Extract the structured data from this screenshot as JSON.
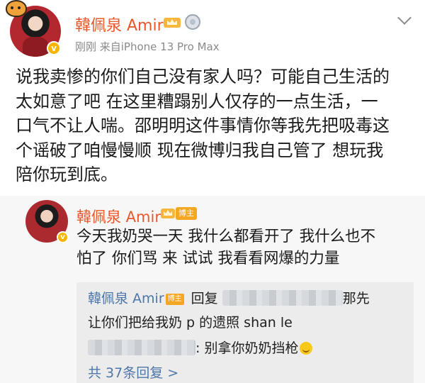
{
  "post": {
    "username": "韓佩泉 Amir",
    "meta": "刚刚  来自iPhone 13 Pro Max",
    "verified_mark": "v",
    "text": "说我卖惨的你们自己没有家人吗？可能自己生活的\n太如意了吧 在这里糟蹋别人仅存的一点生活，一\n口气不让人喘。邵明明这件事情你等我先把吸毒这\n个谣破了咱慢慢顺 现在微博归我自己管了 想玩我\n陪你玩到底。"
  },
  "reply": {
    "username": "韓佩泉 Amir",
    "blogger_tag": "博主",
    "text": "今天我奶哭一天 我什么都看开了 我什么也不\n怕了 你们骂 来 试试 我看看网爆的力量",
    "comments": {
      "line1_user": "韓佩泉 Amir",
      "line1_tag": "博主",
      "line1_action": " 回复 ",
      "line1_tail": "那先",
      "line2": "让你们把给我奶 p 的遗照 shan le",
      "line3_text": ": 别拿你奶奶挡枪",
      "more": "共 37条回复 >"
    }
  },
  "colors": {
    "username": "#e8582b",
    "link": "#4e76a8",
    "badge": "#f5a623"
  }
}
